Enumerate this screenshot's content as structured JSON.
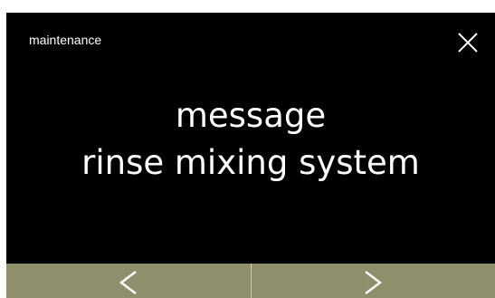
{
  "header": {
    "title": "maintenance",
    "close_icon": "close-icon"
  },
  "message": {
    "line1": "message",
    "line2": "rinse mixing system"
  },
  "nav": {
    "prev_icon": "chevron-left-icon",
    "next_icon": "chevron-right-icon",
    "bar_color": "#8e8f6b"
  },
  "colors": {
    "background": "#000000",
    "text": "#ffffff"
  }
}
